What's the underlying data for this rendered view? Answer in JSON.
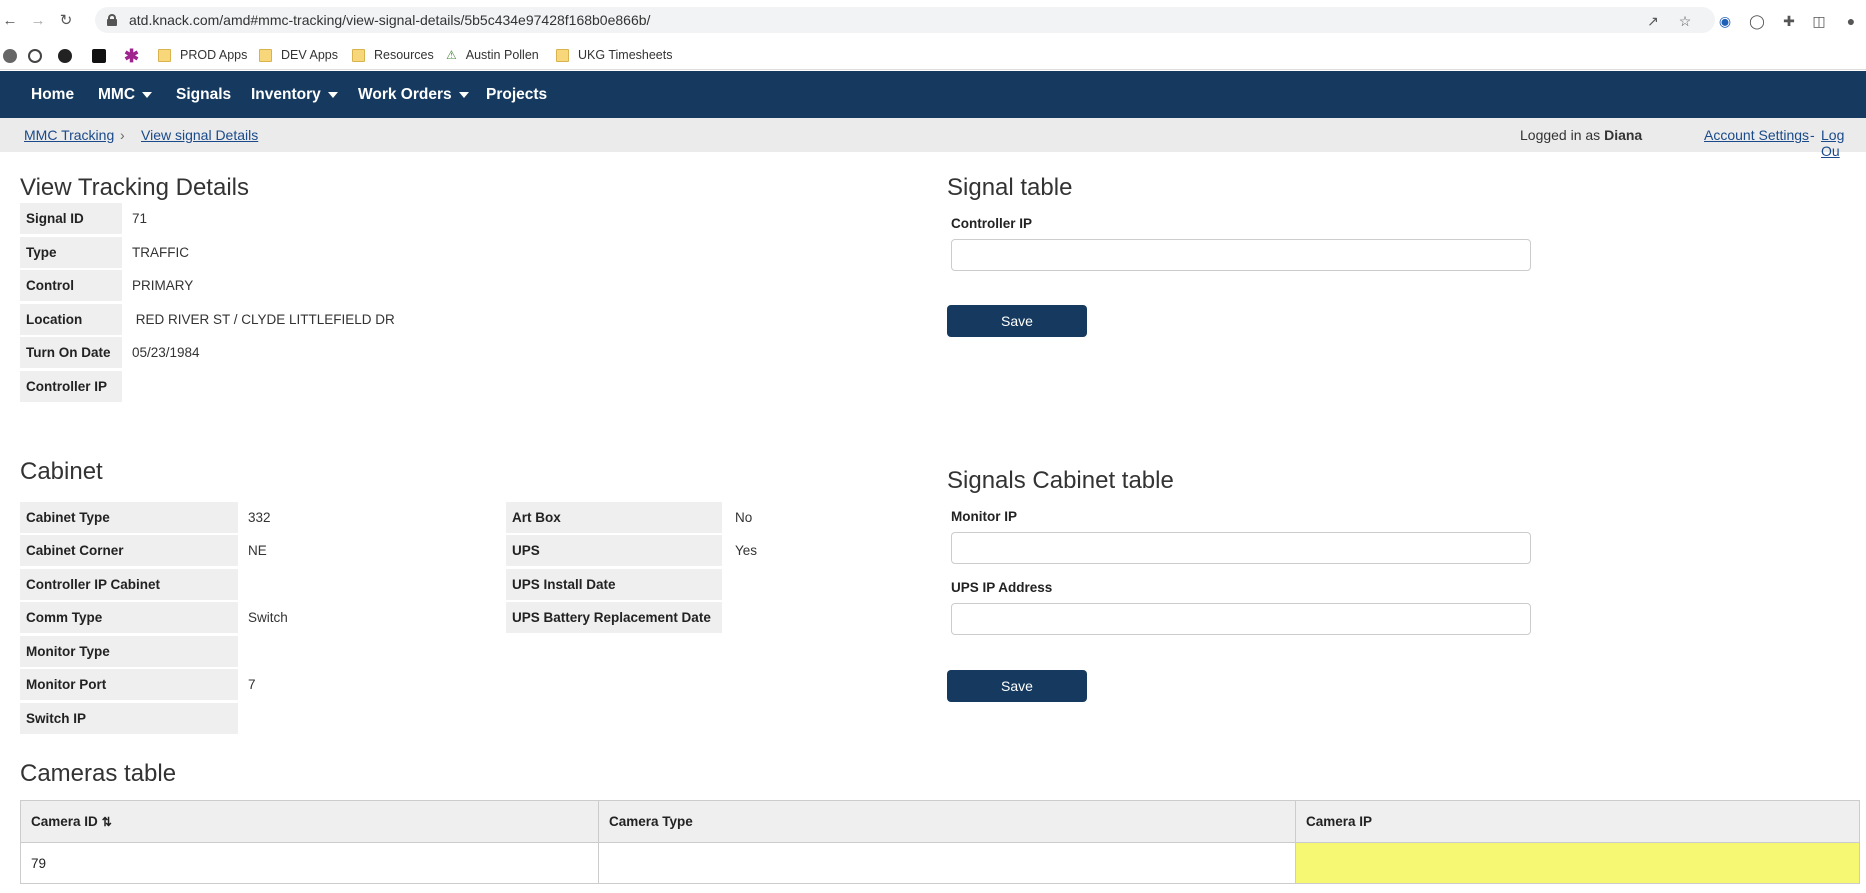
{
  "browser": {
    "url": "atd.knack.com/amd#mmc-tracking/view-signal-details/5b5c434e97428f168b0e866b/",
    "bookmarks": [
      "PROD Apps",
      "DEV Apps",
      "Resources",
      "Austin Pollen",
      "UKG Timesheets"
    ]
  },
  "nav": {
    "items": [
      {
        "label": "Home"
      },
      {
        "label": "MMC"
      },
      {
        "label": "Signals"
      },
      {
        "label": "Inventory"
      },
      {
        "label": "Work Orders"
      },
      {
        "label": "Projects"
      }
    ]
  },
  "breadcrumb": {
    "items": [
      "MMC Tracking",
      "View signal Details"
    ],
    "separator": "›",
    "logged_in_prefix": "Logged in as",
    "user": "Diana",
    "account_settings": "Account Settings",
    "dash": "-",
    "logout": "Log Ou"
  },
  "tracking": {
    "title": "View Tracking Details",
    "fields": [
      {
        "label": "Signal ID",
        "value": "71"
      },
      {
        "label": "Type",
        "value": "TRAFFIC"
      },
      {
        "label": "Control",
        "value": "PRIMARY"
      },
      {
        "label": "Location",
        "value": " RED RIVER ST / CLYDE LITTLEFIELD DR"
      },
      {
        "label": "Turn On Date",
        "value": "05/23/1984"
      },
      {
        "label": "Controller IP",
        "value": ""
      }
    ]
  },
  "signal_table": {
    "title": "Signal table",
    "field_label": "Controller IP",
    "field_value": "",
    "save_label": "Save"
  },
  "cabinet": {
    "title": "Cabinet",
    "left": [
      {
        "label": "Cabinet Type",
        "value": "332"
      },
      {
        "label": "Cabinet Corner",
        "value": "NE"
      },
      {
        "label": "Controller IP Cabinet",
        "value": ""
      },
      {
        "label": "Comm Type",
        "value": "Switch"
      },
      {
        "label": "Monitor Type",
        "value": ""
      },
      {
        "label": "Monitor Port",
        "value": "7"
      },
      {
        "label": "Switch IP",
        "value": ""
      }
    ],
    "right": [
      {
        "label": "Art Box",
        "value": "No"
      },
      {
        "label": "UPS",
        "value": "Yes"
      },
      {
        "label": "UPS Install Date",
        "value": ""
      },
      {
        "label": "UPS Battery Replacement Date",
        "value": ""
      }
    ]
  },
  "cabinet_table": {
    "title": "Signals Cabinet table",
    "monitor_ip_label": "Monitor IP",
    "monitor_ip_value": "",
    "ups_ip_label": "UPS IP Address",
    "ups_ip_value": "",
    "save_label": "Save"
  },
  "cameras": {
    "title": "Cameras table",
    "columns": [
      "Camera ID",
      "Camera Type",
      "Camera IP"
    ],
    "rows": [
      [
        "79",
        "",
        ""
      ]
    ],
    "highlight_color": "#f6f772"
  },
  "colors": {
    "nav_bg": "#163a5f",
    "button_bg": "#163a5f",
    "link": "#1a4a8a"
  }
}
